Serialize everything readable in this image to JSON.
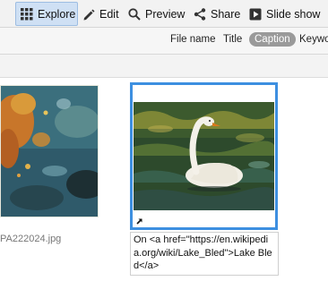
{
  "toolbar": {
    "explore": "Explore",
    "edit": "Edit",
    "preview": "Preview",
    "share": "Share",
    "slideshow": "Slide show"
  },
  "sortbar": {
    "file_name": "File name",
    "title": "Title",
    "caption": "Caption",
    "keywords": "Keywo"
  },
  "thumbs": {
    "left_caption": "PA222024.jpg",
    "selected_caption": "On <a href=\"https://en.wikipedia.org/wiki/Lake_Bled\">Lake Bled</a>"
  },
  "colors": {
    "selection": "#3d8fe0",
    "active_button": "#cfe0f4"
  },
  "icons": [
    "grid-icon",
    "pencil-icon",
    "magnifier-icon",
    "share-icon",
    "play-icon",
    "link-arrow-icon"
  ]
}
